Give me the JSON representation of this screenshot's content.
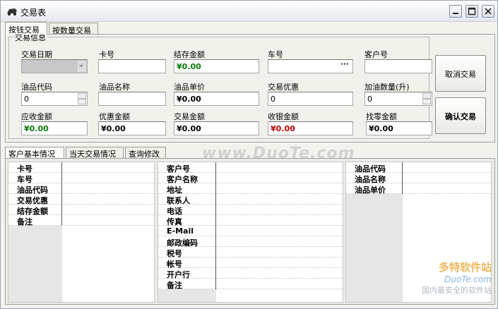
{
  "window": {
    "title": "交易表"
  },
  "top_tabs": [
    {
      "label": "按钱交易"
    },
    {
      "label": "按数量交易"
    }
  ],
  "group_title": "交易信息",
  "fields": {
    "trade_date": {
      "label": "交易日期",
      "value": ""
    },
    "card_no": {
      "label": "卡号",
      "value": ""
    },
    "balance": {
      "label": "结存金额",
      "value": "¥0.00"
    },
    "car_no": {
      "label": "车号",
      "value": ""
    },
    "customer_no": {
      "label": "客户号",
      "value": ""
    },
    "oil_code": {
      "label": "油品代码",
      "value": "0"
    },
    "oil_name": {
      "label": "油品名称",
      "value": ""
    },
    "oil_price": {
      "label": "油品单价",
      "value": "¥0.00"
    },
    "trade_discount": {
      "label": "交易优惠",
      "value": "0"
    },
    "fuel_qty": {
      "label": "加油数量(升)",
      "value": "0"
    },
    "receivable": {
      "label": "应收金额",
      "value": "¥0.00"
    },
    "discount_amt": {
      "label": "优惠金额",
      "value": "¥0.00"
    },
    "trade_amt": {
      "label": "交易金额",
      "value": "¥0.00"
    },
    "cash_amt": {
      "label": "收银金额",
      "value": "¥0.00"
    },
    "change_amt": {
      "label": "找零金额",
      "value": "¥0.00"
    }
  },
  "buttons": {
    "cancel": "取消交易",
    "confirm": "确认交易"
  },
  "bottom_tabs": [
    {
      "label": "客户基本情况"
    },
    {
      "label": "当天交易情况"
    },
    {
      "label": "查询修改"
    }
  ],
  "grid1": [
    "卡号",
    "车号",
    "油品代码",
    "交易优惠",
    "结存金额",
    "备注"
  ],
  "grid2": [
    "客户号",
    "客户名称",
    "地址",
    "联系人",
    "电话",
    "传真",
    "E-Mail",
    "邮政编码",
    "税号",
    "帐号",
    "开户行",
    "备注"
  ],
  "grid3": [
    "油品代码",
    "油品名称",
    "油品单价"
  ],
  "watermark": {
    "main": "www.DuoTe.com",
    "brand": "多特软件站",
    "site": "DuoTe.com",
    "slogan": "国内最安全的软件站"
  },
  "colors": {
    "green": "#0a7a0a",
    "red": "#c00000"
  }
}
